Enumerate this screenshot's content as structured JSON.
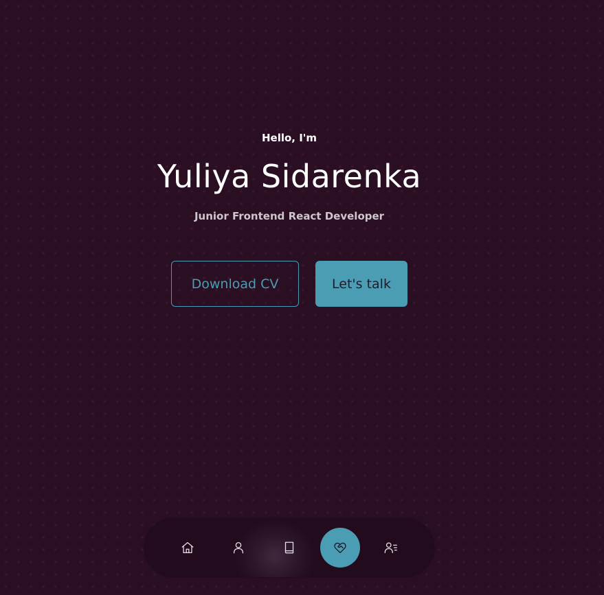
{
  "hero": {
    "greeting": "Hello, I'm",
    "name": "Yuliya Sidarenka",
    "role": "Junior Frontend React Developer"
  },
  "buttons": {
    "download_cv": "Download CV",
    "lets_talk": "Let's talk"
  },
  "nav": {
    "items": [
      {
        "icon": "home-icon",
        "active": false
      },
      {
        "icon": "user-icon",
        "active": false
      },
      {
        "icon": "book-icon",
        "active": false
      },
      {
        "icon": "heart-handshake-icon",
        "active": true
      },
      {
        "icon": "contact-list-icon",
        "active": false
      }
    ]
  },
  "colors": {
    "background": "#2a0f23",
    "accent": "#4a9db3",
    "dock": "#220b1c",
    "text": "#ffffff"
  }
}
